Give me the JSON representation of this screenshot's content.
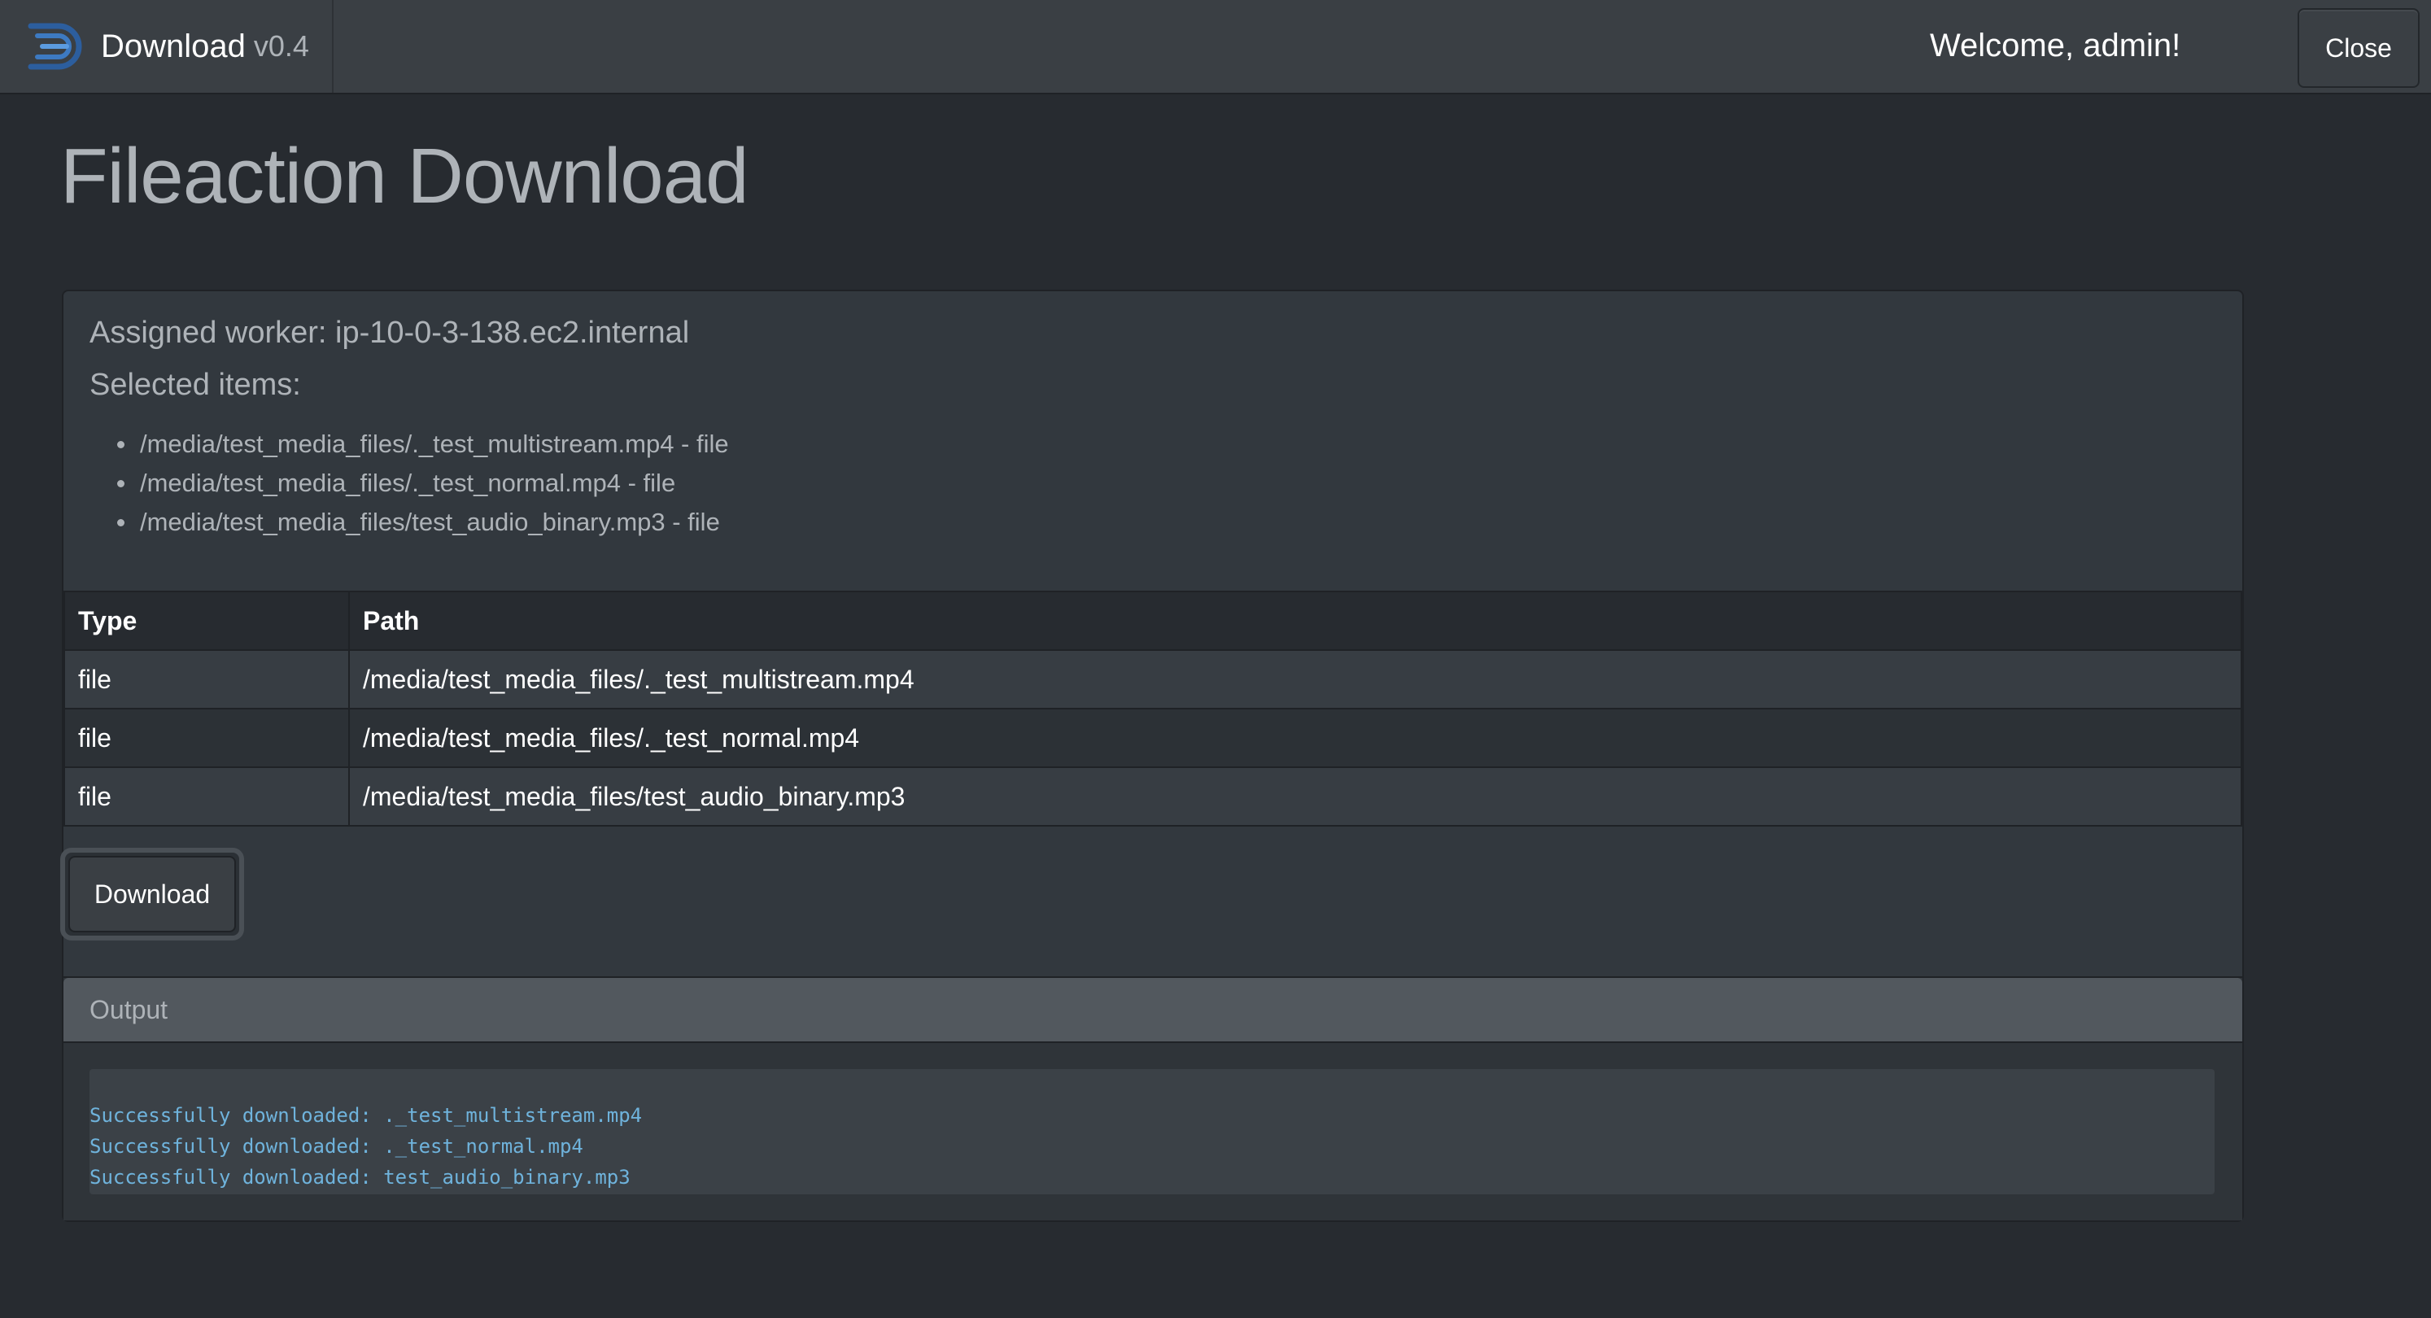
{
  "navbar": {
    "brand_name": "Download",
    "brand_version": "v0.4",
    "welcome_text": "Welcome, admin!",
    "close_label": "Close"
  },
  "page": {
    "title": "Fileaction Download"
  },
  "card": {
    "worker_line": "Assigned worker: ip-10-0-3-138.ec2.internal",
    "selected_label": "Selected items:",
    "items": [
      "/media/test_media_files/._test_multistream.mp4 - file",
      "/media/test_media_files/._test_normal.mp4 - file",
      "/media/test_media_files/test_audio_binary.mp3 - file"
    ]
  },
  "table": {
    "headers": [
      "Type",
      "Path"
    ],
    "rows": [
      {
        "type": "file",
        "path": "/media/test_media_files/._test_multistream.mp4"
      },
      {
        "type": "file",
        "path": "/media/test_media_files/._test_normal.mp4"
      },
      {
        "type": "file",
        "path": "/media/test_media_files/test_audio_binary.mp3"
      }
    ]
  },
  "actions": {
    "download_label": "Download"
  },
  "output": {
    "header": "Output",
    "lines": [
      "Successfully downloaded: ._test_multistream.mp4",
      "Successfully downloaded: ._test_normal.mp4",
      "Successfully downloaded: test_audio_binary.mp3"
    ]
  },
  "icons": {
    "brand_logo": "download-logo-icon"
  },
  "colors": {
    "background": "#272b30",
    "navbar": "#3a3f44",
    "card": "#32383e",
    "output_text": "#6fb3dc",
    "logo_accent": "#3d7ac2"
  }
}
